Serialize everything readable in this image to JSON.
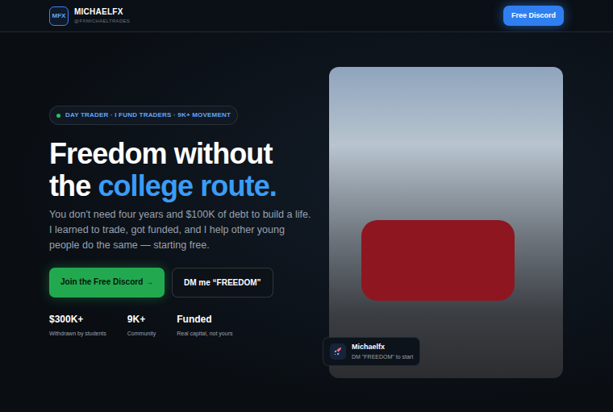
{
  "header": {
    "logo": "MFX",
    "brand": "MICHAELFX",
    "handle": "@FXMICHAELTRADES",
    "cta": "Free Discord"
  },
  "hero": {
    "badge": "DAY TRADER · I FUND TRADERS · 9K+ MOVEMENT",
    "headline_line1": "Freedom without",
    "headline_line2": "the ",
    "headline_highlight": "college route.",
    "paragraph": "You don't need four years and $100K of debt to build a life. I learned to trade, got funded, and I help other young people do the same — starting free.",
    "primary_button": "Join the Free Discord →",
    "secondary_button": "DM me “FREEDOM”",
    "stats": [
      {
        "value": "$300K+",
        "label": "Withdrawn by students"
      },
      {
        "value": "9K+",
        "label": "Community"
      },
      {
        "value": "Funded",
        "label": "Real capital, not yours"
      }
    ]
  },
  "profile_card": {
    "name": "Michaelfx",
    "subtitle": "DM \"FREEDOM\" to start"
  }
}
